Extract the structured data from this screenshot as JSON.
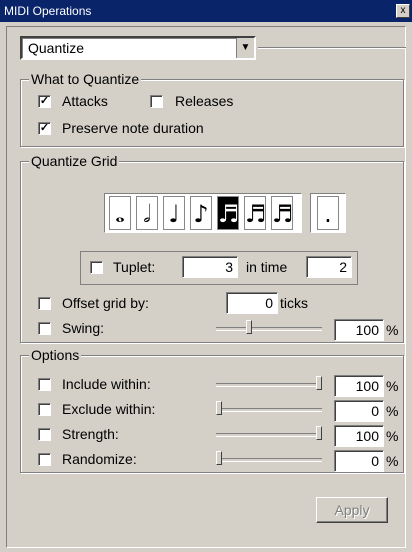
{
  "window": {
    "title": "MIDI Operations",
    "close_glyph": "x"
  },
  "operation": {
    "selected": "Quantize",
    "arrow_icon": "chevron-down-icon"
  },
  "what_to_quantize": {
    "title": "What to Quantize",
    "attacks": {
      "label": "Attacks",
      "checked": true
    },
    "releases": {
      "label": "Releases",
      "checked": false
    },
    "preserve": {
      "label": "Preserve note duration",
      "checked": true
    }
  },
  "quantize_grid": {
    "title": "Quantize Grid",
    "notes": [
      {
        "name": "whole-note",
        "glyph": "𝅝",
        "selected": false
      },
      {
        "name": "half-note",
        "glyph": "𝅗𝅥",
        "selected": false
      },
      {
        "name": "quarter-note",
        "glyph": "♩",
        "selected": false
      },
      {
        "name": "eighth-note",
        "glyph": "♪",
        "selected": false
      },
      {
        "name": "sixteenth-note",
        "glyph": "♬",
        "selected": true
      },
      {
        "name": "thirty-second-note",
        "glyph": "♬",
        "selected": false
      },
      {
        "name": "sixty-fourth-note",
        "glyph": "♬",
        "selected": false
      }
    ],
    "dot_glyph": ".",
    "tuplet": {
      "label": "Tuplet:",
      "checked": false,
      "value": "3",
      "in_time_label": "in time",
      "in_time_value": "2"
    },
    "offset": {
      "label": "Offset grid by:",
      "checked": false,
      "value": "0",
      "unit": "ticks"
    },
    "swing": {
      "label": "Swing:",
      "checked": false,
      "value": "100",
      "unit": "%",
      "level": 0.3
    }
  },
  "options": {
    "title": "Options",
    "rows": [
      {
        "label": "Include within:",
        "checked": false,
        "value": "100",
        "unit": "%",
        "level": 1.0
      },
      {
        "label": "Exclude within:",
        "checked": false,
        "value": "0",
        "unit": "%",
        "level": 0.0
      },
      {
        "label": "Strength:",
        "checked": false,
        "value": "100",
        "unit": "%",
        "level": 1.0
      },
      {
        "label": "Randomize:",
        "checked": false,
        "value": "0",
        "unit": "%",
        "level": 0.0
      }
    ]
  },
  "apply_label": "Apply"
}
